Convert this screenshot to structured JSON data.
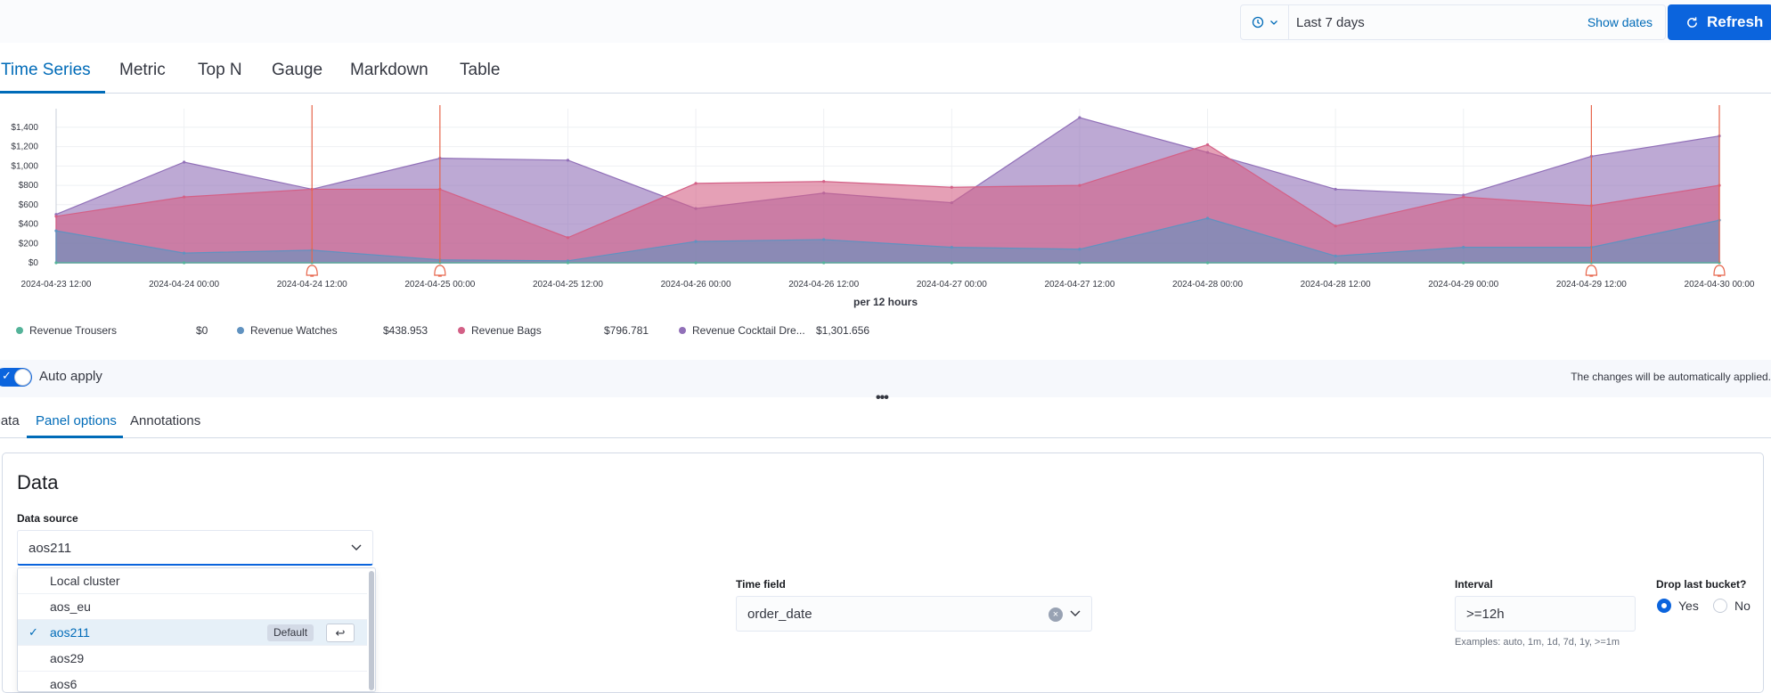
{
  "timepicker": {
    "range": "Last 7 days",
    "show_dates": "Show dates",
    "refresh": "Refresh"
  },
  "tabs": [
    "Time Series",
    "Metric",
    "Top N",
    "Gauge",
    "Markdown",
    "Table"
  ],
  "colors": {
    "accent": "#006bb8",
    "trousers": "#54b399",
    "watches": "#6092c0",
    "bags": "#d36086",
    "cocktail": "#9170b8"
  },
  "chart_data": {
    "type": "area",
    "xlabel": "per 12 hours",
    "ylim": [
      0,
      1500
    ],
    "y_ticks": [
      "$0",
      "$200",
      "$400",
      "$600",
      "$800",
      "$1,000",
      "$1,200",
      "$1,400"
    ],
    "x_ticks": [
      "2024-04-23 12:00",
      "2024-04-24 00:00",
      "2024-04-24 12:00",
      "2024-04-25 00:00",
      "2024-04-25 12:00",
      "2024-04-26 00:00",
      "2024-04-26 12:00",
      "2024-04-27 00:00",
      "2024-04-27 12:00",
      "2024-04-28 00:00",
      "2024-04-28 12:00",
      "2024-04-29 00:00",
      "2024-04-29 12:00",
      "2024-04-30 00:00"
    ],
    "series": [
      {
        "name": "Revenue Trousers",
        "legend_value": "$0",
        "values": [
          0,
          0,
          0,
          0,
          0,
          0,
          0,
          0,
          0,
          0,
          0,
          0,
          0,
          0
        ]
      },
      {
        "name": "Revenue Watches",
        "legend_value": "$438.953",
        "values": [
          330,
          100,
          130,
          30,
          20,
          220,
          240,
          160,
          140,
          460,
          70,
          160,
          160,
          440
        ]
      },
      {
        "name": "Revenue Bags",
        "legend_value": "$796.781",
        "values": [
          480,
          680,
          760,
          760,
          260,
          820,
          840,
          780,
          800,
          1220,
          380,
          680,
          590,
          800
        ]
      },
      {
        "name": "Revenue Cocktail Dre...",
        "legend_value": "$1,301.656",
        "values": [
          500,
          1040,
          760,
          1080,
          1060,
          560,
          720,
          620,
          1500,
          1140,
          760,
          700,
          1100,
          1310
        ]
      }
    ],
    "annotations_at": [
      "2024-04-24 12:00",
      "2024-04-25 00:00",
      "2024-04-29 12:00",
      "2024-04-30 00:00"
    ],
    "grid": true
  },
  "auto_apply": {
    "label": "Auto apply",
    "note": "The changes will be automatically applied."
  },
  "subtabs": [
    "Data",
    "Panel options",
    "Annotations"
  ],
  "panel": {
    "title": "Data",
    "data_source_label": "Data source",
    "data_source_value": "aos211",
    "options": [
      "Local cluster",
      "aos_eu",
      "aos211",
      "aos29",
      "aos6"
    ],
    "default_badge": "Default",
    "enter_symbol": "↩",
    "time_field_label": "Time field",
    "time_field_value": "order_date",
    "interval_label": "Interval",
    "interval_value": ">=12h",
    "interval_help": "Examples: auto, 1m, 1d, 7d, 1y, >=1m",
    "drop_last_label": "Drop last bucket?",
    "yes": "Yes",
    "no": "No"
  }
}
